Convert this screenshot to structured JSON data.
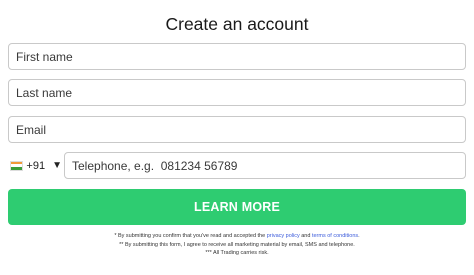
{
  "title": "Create an account",
  "form": {
    "first_name_placeholder": "First name",
    "last_name_placeholder": "Last name",
    "email_placeholder": "Email",
    "country_code": "+91",
    "country_flag": "india-flag-icon",
    "telephone_placeholder": "Telephone, e.g.  081234 56789",
    "submit_label": "LEARN MORE"
  },
  "colors": {
    "button": "#2ecc71",
    "link": "#3b5bdb"
  },
  "disclaimer": {
    "line1_prefix": "* By submitting you confirm that you've read and accepted the",
    "privacy_link": "privacy policy",
    "line1_and": "and",
    "terms_link": "terms of conditions",
    "line1_suffix": ".",
    "line2": "** By submitting this form, I agree to receive all marketing material by email, SMS and telephone.",
    "line3": "*** All Trading carries risk."
  }
}
